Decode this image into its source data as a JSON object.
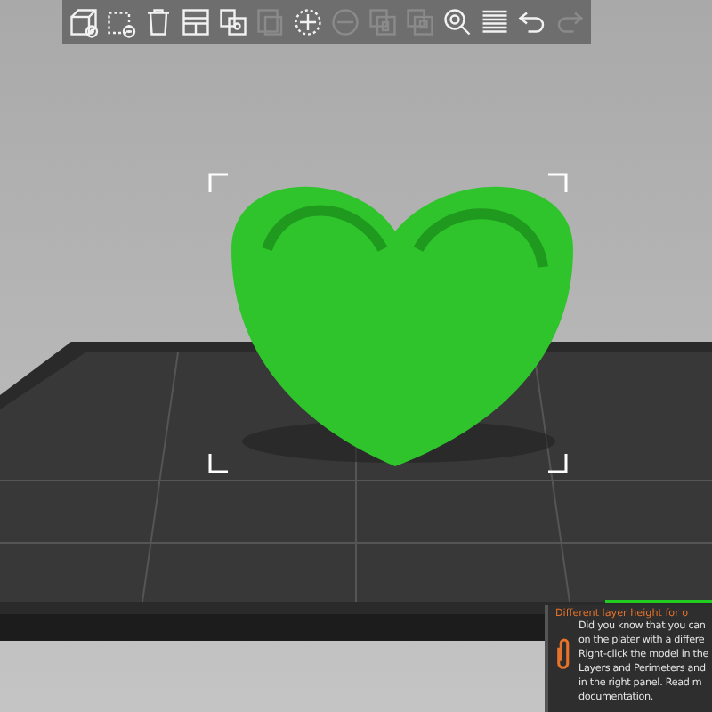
{
  "toolbar": {
    "buttons": [
      {
        "kind": "add",
        "disabled": false
      },
      {
        "kind": "delete",
        "disabled": false
      },
      {
        "kind": "delete_all",
        "disabled": false
      },
      {
        "kind": "arrange",
        "disabled": false
      },
      {
        "kind": "copy",
        "disabled": false
      },
      {
        "kind": "paste",
        "disabled": true
      },
      {
        "kind": "add_instance",
        "disabled": false
      },
      {
        "kind": "remove_instance",
        "disabled": true
      },
      {
        "kind": "split_objects",
        "disabled": true
      },
      {
        "kind": "split_parts",
        "disabled": true
      },
      {
        "kind": "search",
        "disabled": false
      },
      {
        "kind": "layers",
        "disabled": false
      },
      {
        "kind": "undo",
        "disabled": false
      },
      {
        "kind": "redo",
        "disabled": true
      }
    ]
  },
  "hint": {
    "title": "Different layer height for o",
    "lines": [
      "Did you know that you can",
      "on the plater with a differe",
      "Right-click the model in the",
      "Layers and Perimeters and",
      "in the right panel. Read m",
      "documentation."
    ]
  }
}
